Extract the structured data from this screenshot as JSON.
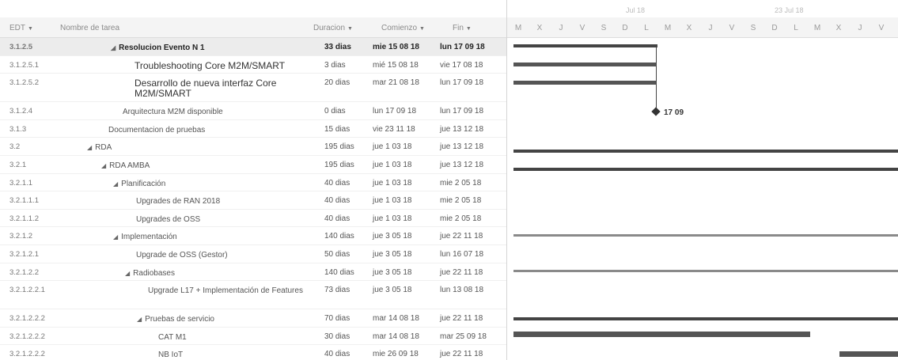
{
  "header": {
    "edt": "EDT",
    "nombre": "Nombre de tarea",
    "duracion": "Duracion",
    "comienzo": "Comienzo",
    "fin": "Fin"
  },
  "gantt": {
    "week1": "Jul 18",
    "week2": "23 Jul 18",
    "days": [
      "M",
      "X",
      "J",
      "V",
      "S",
      "D",
      "L",
      "M",
      "X",
      "J",
      "V",
      "S",
      "D",
      "L",
      "M",
      "X",
      "J",
      "V"
    ],
    "milestone_label": "17 09"
  },
  "rows": [
    {
      "edt": "3.1.2.5",
      "name": "Resolucion Evento N 1",
      "dur": "33 dias",
      "start": "mie 15 08 18",
      "end": "lun 17 09 18"
    },
    {
      "edt": "3.1.2.5.1",
      "name": "Troubleshooting Core M2M/SMART",
      "dur": "3 dias",
      "start": "mié 15 08 18",
      "end": "vie 17 08 18"
    },
    {
      "edt": "3.1.2.5.2",
      "name": "Desarrollo de nueva interfaz Core M2M/SMART",
      "dur": "20 dias",
      "start": "mar 21 08 18",
      "end": "lun 17 09 18"
    },
    {
      "edt": "3.1.2.4",
      "name": "Arquitectura M2M disponible",
      "dur": "0 dias",
      "start": "lun 17 09 18",
      "end": "lun 17 09 18"
    },
    {
      "edt": "3.1.3",
      "name": "Documentacion de pruebas",
      "dur": "15 dias",
      "start": "vie 23 11 18",
      "end": "jue 13 12 18"
    },
    {
      "edt": "3.2",
      "name": "RDA",
      "dur": "195 dias",
      "start": "jue 1 03 18",
      "end": "jue 13 12 18"
    },
    {
      "edt": "3.2.1",
      "name": "RDA AMBA",
      "dur": "195 dias",
      "start": "jue 1 03 18",
      "end": "jue 13 12 18"
    },
    {
      "edt": "3.2.1.1",
      "name": "Planificación",
      "dur": "40 dias",
      "start": "jue 1 03 18",
      "end": "mie 2 05 18"
    },
    {
      "edt": "3.2.1.1.1",
      "name": "Upgrades de RAN 2018",
      "dur": "40 dias",
      "start": "jue 1 03 18",
      "end": "mie 2 05 18"
    },
    {
      "edt": "3.2.1.1.2",
      "name": "Upgrades de OSS",
      "dur": "40 dias",
      "start": "jue 1 03 18",
      "end": "mie 2 05 18"
    },
    {
      "edt": "3.2.1.2",
      "name": "Implementación",
      "dur": "140 dias",
      "start": "jue 3 05 18",
      "end": "jue 22 11 18"
    },
    {
      "edt": "3.2.1.2.1",
      "name": "Upgrade de OSS (Gestor)",
      "dur": "50 dias",
      "start": "jue 3 05 18",
      "end": "lun 16 07 18"
    },
    {
      "edt": "3.2.1.2.2",
      "name": "Radiobases",
      "dur": "140 dias",
      "start": "jue 3 05 18",
      "end": "jue 22 11 18"
    },
    {
      "edt": "3.2.1.2.2.1",
      "name": "Upgrade L17 + Implementación de Features",
      "dur": "73 dias",
      "start": "jue 3 05 18",
      "end": "lun 13 08 18"
    },
    {
      "edt": "3.2.1.2.2.2",
      "name": "Pruebas de servicio",
      "dur": "70 dias",
      "start": "mar 14 08 18",
      "end": "jue 22 11 18"
    },
    {
      "edt": "3.2.1.2.2.2",
      "name": "CAT M1",
      "dur": "30 dias",
      "start": "mar 14 08 18",
      "end": "mar 25 09 18"
    },
    {
      "edt": "3.2.1.2.2.2",
      "name": "NB IoT",
      "dur": "40 dias",
      "start": "mie 26 09 18",
      "end": "jue 22 11 18"
    }
  ]
}
